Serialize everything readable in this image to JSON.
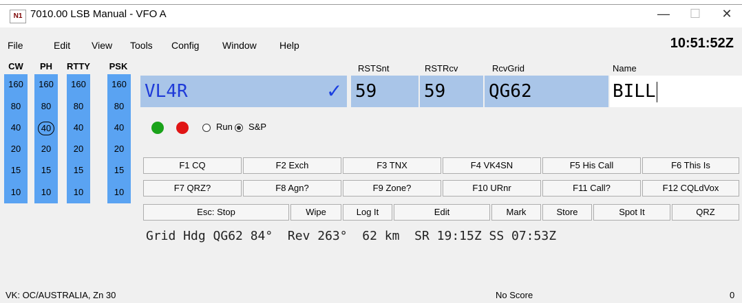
{
  "window": {
    "title": "7010.00 LSB Manual - VFO A",
    "icon_text": "N1",
    "minimize": "—",
    "maximize": "☐",
    "close": "✕"
  },
  "menu": [
    "File",
    "Edit",
    "View",
    "Tools",
    "Config",
    "Window",
    "Help"
  ],
  "clock": "10:51:52Z",
  "bands": {
    "headers": [
      "CW",
      "PH",
      "RTTY",
      "PSK"
    ],
    "values": [
      "160",
      "80",
      "40",
      "20",
      "15",
      "10"
    ],
    "selected": {
      "mode": "PH",
      "band": "40"
    }
  },
  "fields": {
    "call": "VL4R",
    "check_icon": "✓",
    "rst_sent_label": "RSTSnt",
    "rst_sent": "59",
    "rst_rcv_label": "RSTRcv",
    "rst_rcv": "59",
    "rcv_grid_label": "RcvGrid",
    "rcv_grid": "QG62",
    "name_label": "Name",
    "name": "BILL"
  },
  "mode_radios": {
    "run": "Run",
    "sp": "S&P",
    "selected": "S&P"
  },
  "status_dots": {
    "green": "#1aa31a",
    "red": "#e01515"
  },
  "function_keys": {
    "row1": [
      "F1 CQ",
      "F2 Exch",
      "F3 TNX",
      "F4 VK4SN",
      "F5 His Call",
      "F6 This Is"
    ],
    "row2": [
      "F7 QRZ?",
      "F8 Agn?",
      "F9 Zone?",
      "F10 URnr",
      "F11 Call?",
      "F12 CQLdVox"
    ],
    "row3": [
      "Esc: Stop",
      "Wipe",
      "Log It",
      "Edit",
      "Mark",
      "Store",
      "Spot It",
      "QRZ"
    ]
  },
  "info_line": "Grid Hdg QG62 84°  Rev 263°  62 km  SR 19:15Z SS 07:53Z",
  "statusbar": {
    "left": "VK: OC/AUSTRALIA, Zn 30",
    "center": "No Score",
    "right": "0"
  }
}
